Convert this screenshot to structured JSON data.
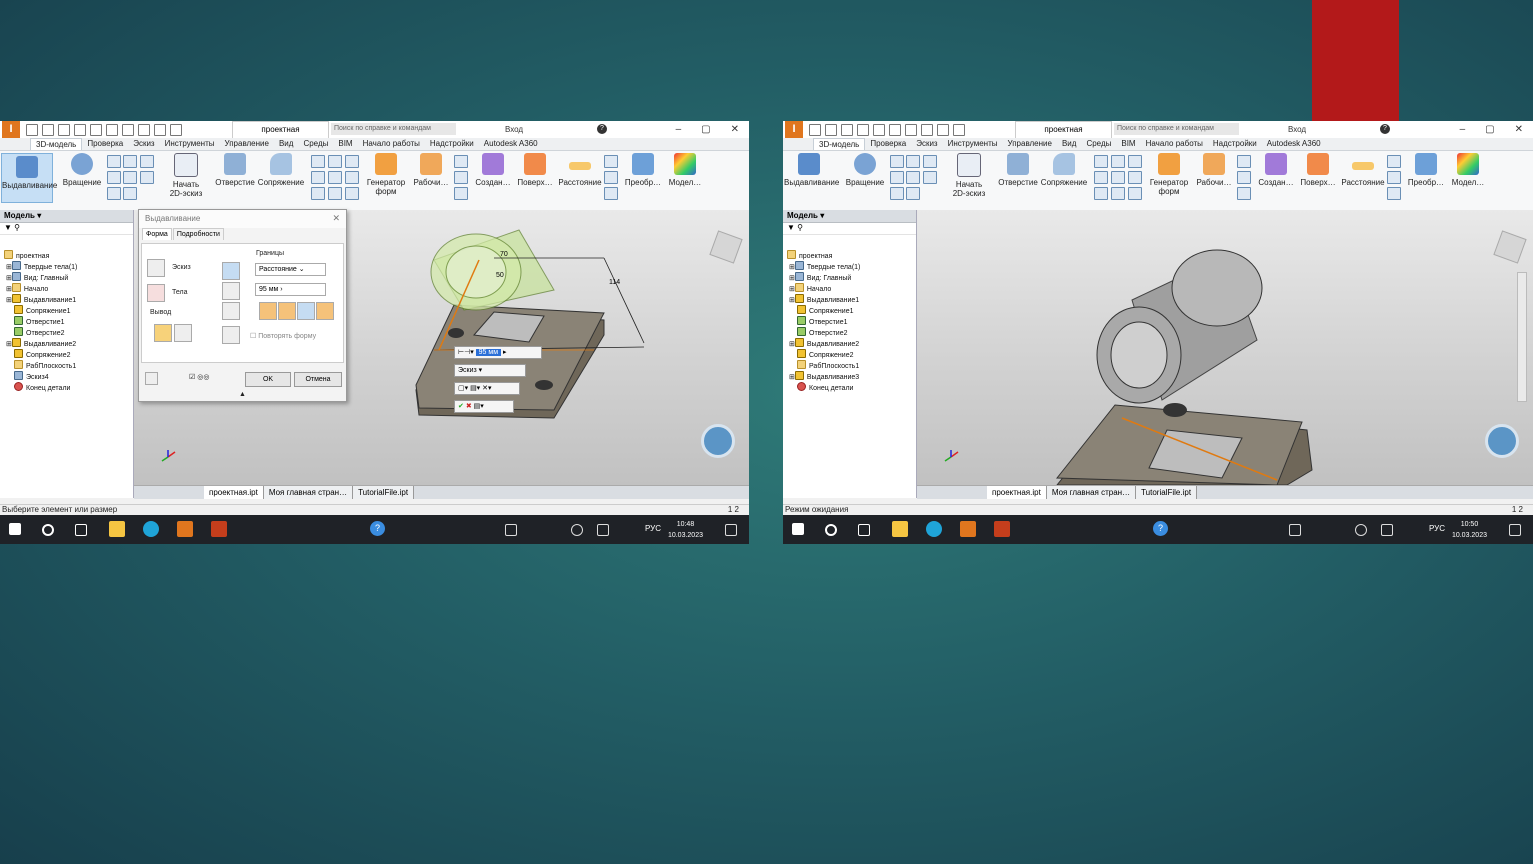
{
  "screens": [
    {
      "doc_title": "проектная",
      "search_placeholder": "Поиск по справке и командам",
      "login": "Вход",
      "menu": [
        "3D-модель",
        "Проверка",
        "Эскиз",
        "Инструменты",
        "Управление",
        "Вид",
        "Среды",
        "BIM",
        "Начало работы",
        "Надстройки",
        "Autodesk A360"
      ],
      "ribbon": {
        "extrude": "Выдавливание",
        "revolve": "Вращение",
        "sketch_line1": "Начать",
        "sketch_line2": "2D-эскиз",
        "hole": "Отверстие",
        "fillet": "Сопряжение",
        "shape_gen1": "Генератор",
        "shape_gen2": "форм",
        "work": "Рабочи…",
        "create": "Создан…",
        "surface": "Поверх…",
        "distance": "Расстояние",
        "convert": "Преобр…",
        "model": "Модел…"
      },
      "browser_header": "Модель ▾",
      "tree": [
        "проектная",
        "Твердые тела(1)",
        "Вид: Главный",
        "Начало",
        "Выдавливание1",
        "Сопряжение1",
        "Отверстие1",
        "Отверстие2",
        "Выдавливание2",
        "Сопряжение2",
        "РабПлоскость1",
        "Эскиз4",
        "Конец детали"
      ],
      "tabs": [
        "проектная.ipt",
        "Моя главная стран…",
        "TutorialFile.ipt"
      ],
      "status": "Выберите элемент или размер",
      "pages": "1    2",
      "time": "10:48",
      "date": "10.03.2023",
      "lang": "РУС",
      "dialog": {
        "title": "Выдавливание",
        "tab_shape": "Форма",
        "tab_details": "Подробности",
        "sketch": "Эскиз",
        "bodies": "Тела",
        "output": "Вывод",
        "bounds": "Границы",
        "bounds_type": "Расстояние",
        "distance": "95 мм",
        "repeat": "Повторять форму",
        "ok": "OK",
        "cancel": "Отмена"
      },
      "minitool": {
        "distance": "95 мм",
        "profile": "Эскиз"
      },
      "dims": {
        "d1": "70",
        "d2": "50",
        "d3": "114"
      }
    },
    {
      "doc_title": "проектная",
      "search_placeholder": "Поиск по справке и командам",
      "login": "Вход",
      "menu": [
        "3D-модель",
        "Проверка",
        "Эскиз",
        "Инструменты",
        "Управление",
        "Вид",
        "Среды",
        "BIM",
        "Начало работы",
        "Надстройки",
        "Autodesk A360"
      ],
      "ribbon": {
        "extrude": "Выдавливание",
        "revolve": "Вращение",
        "sketch_line1": "Начать",
        "sketch_line2": "2D-эскиз",
        "hole": "Отверстие",
        "fillet": "Сопряжение",
        "shape_gen1": "Генератор",
        "shape_gen2": "форм",
        "work": "Рабочи…",
        "create": "Создан…",
        "surface": "Поверх…",
        "distance": "Расстояние",
        "convert": "Преобр…",
        "model": "Модел…"
      },
      "browser_header": "Модель ▾",
      "tree": [
        "проектная",
        "Твердые тела(1)",
        "Вид: Главный",
        "Начало",
        "Выдавливание1",
        "Сопряжение1",
        "Отверстие1",
        "Отверстие2",
        "Выдавливание2",
        "Сопряжение2",
        "РабПлоскость1",
        "Выдавливание3",
        "Конец детали"
      ],
      "tabs": [
        "проектная.ipt",
        "Моя главная стран…",
        "TutorialFile.ipt"
      ],
      "status": "Режим ожидания",
      "pages": "1    2",
      "time": "10:50",
      "date": "10.03.2023",
      "lang": "РУС"
    }
  ]
}
